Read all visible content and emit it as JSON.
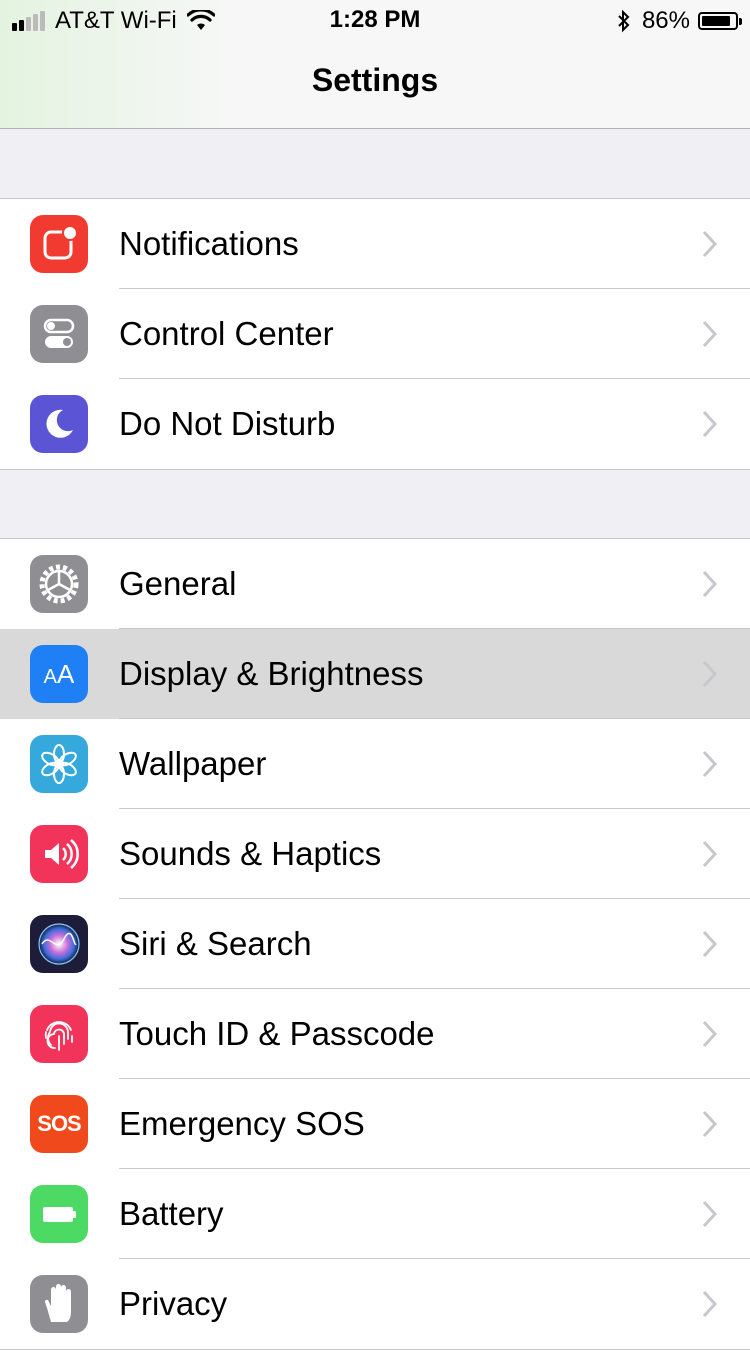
{
  "status_bar": {
    "carrier": "AT&T Wi-Fi",
    "time": "1:28 PM",
    "battery_percent": "86%",
    "battery_level": 0.86,
    "signal_bars_filled": 2,
    "icons": [
      "signal-icon",
      "wifi-icon",
      "bluetooth-icon",
      "battery-icon"
    ]
  },
  "nav": {
    "title": "Settings"
  },
  "groups": [
    {
      "items": [
        {
          "label": "Notifications",
          "icon": "notifications-icon",
          "color": "#f23b30"
        },
        {
          "label": "Control Center",
          "icon": "control-center-icon",
          "color": "#8e8e93"
        },
        {
          "label": "Do Not Disturb",
          "icon": "moon-icon",
          "color": "#5b55d6"
        }
      ]
    },
    {
      "items": [
        {
          "label": "General",
          "icon": "gear-icon",
          "color": "#8e8e93"
        },
        {
          "label": "Display & Brightness",
          "icon": "text-size-icon",
          "color": "#1f7ff5",
          "selected": true
        },
        {
          "label": "Wallpaper",
          "icon": "flower-icon",
          "color": "#35a9dc"
        },
        {
          "label": "Sounds & Haptics",
          "icon": "speaker-icon",
          "color": "#f2345a"
        },
        {
          "label": "Siri & Search",
          "icon": "siri-icon",
          "color": "#1d1d3a"
        },
        {
          "label": "Touch ID & Passcode",
          "icon": "fingerprint-icon",
          "color": "#f2345a"
        },
        {
          "label": "Emergency SOS",
          "icon": "sos-icon",
          "icon_text": "SOS",
          "color": "#f04a1c"
        },
        {
          "label": "Battery",
          "icon": "battery-setting-icon",
          "color": "#4cd964"
        },
        {
          "label": "Privacy",
          "icon": "hand-icon",
          "color": "#8e8e93"
        }
      ]
    }
  ]
}
